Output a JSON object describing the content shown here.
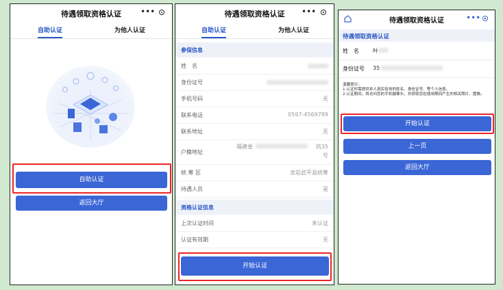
{
  "phone1": {
    "title": "待遇领取资格认证",
    "dots": "•••",
    "tabs": [
      "自助认证",
      "为他人认证"
    ],
    "primary_button": "自助认证",
    "secondary_button": "返回大厅"
  },
  "phone2": {
    "title": "待遇领取资格认证",
    "dots": "•••",
    "tabs": [
      "自助认证",
      "为他人认证"
    ],
    "section1": "参保信息",
    "rows": [
      {
        "label": "姓　名",
        "value": ""
      },
      {
        "label": "身份证号",
        "value": ""
      },
      {
        "label": "手机号码",
        "value": "无"
      },
      {
        "label": "联系电话",
        "value": "0597-4569789"
      },
      {
        "label": "联系地址",
        "value": "无"
      },
      {
        "label": "户籍地址",
        "value": "福建省",
        "value2": "坑35",
        "value3": "号"
      },
      {
        "label": "统 筹 区",
        "value": "龙岩武平县统筹"
      },
      {
        "label": "待遇人员",
        "value": "是"
      }
    ],
    "section2": "资格认证信息",
    "rows2": [
      {
        "label": "上次认证时间",
        "value": "未认证"
      },
      {
        "label": "认证有效期",
        "value": "无"
      }
    ],
    "button": "开始认证"
  },
  "phone3": {
    "title": "待遇领取资格认证",
    "dots": "•••",
    "heading": "待遇领取资格认证",
    "name_label": "姓　名",
    "name_value": "叶",
    "id_label": "身份证号",
    "id_value": "35",
    "tips_title": "温馨提示：",
    "tips_1": "1.认证时需提供本人真实有效的姓名、身份证号、等个人信息。",
    "tips_2": "2.认证期间，将访问您的手机摄像头，并获取您在使用期间产生的相关照片、图像。",
    "buttons": [
      "开始认证",
      "上一页",
      "返回大厅"
    ]
  },
  "colors": {
    "accent": "#3b66d6",
    "highlight": "#e22222",
    "background": "#cfe8cf"
  }
}
